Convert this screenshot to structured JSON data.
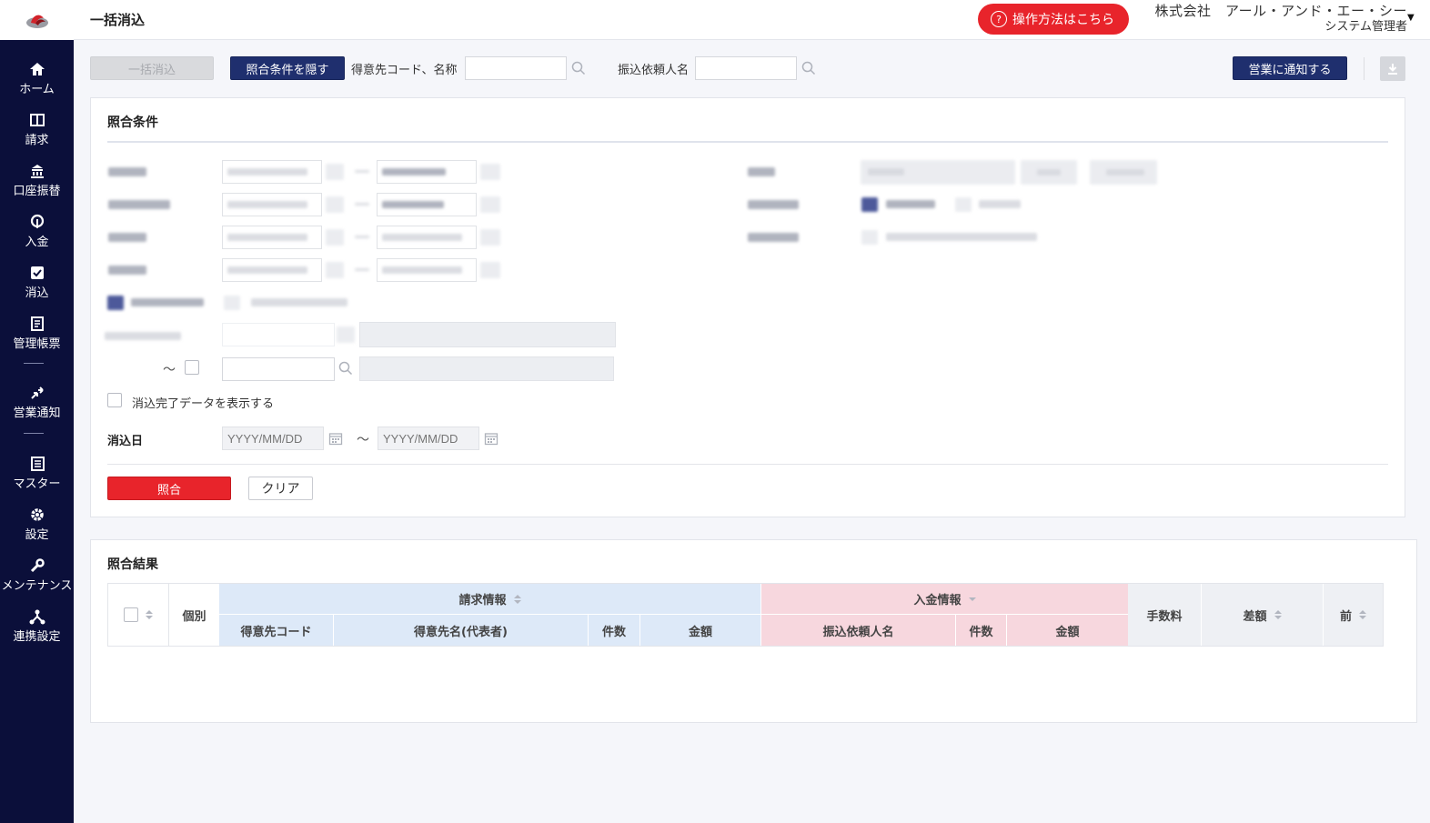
{
  "header": {
    "title": "一括消込",
    "help_button": "操作方法はこちら",
    "company": "株式会社　アール・アンド・エー・シー",
    "role": "システム管理者"
  },
  "sidebar": {
    "items": [
      {
        "label": "ホーム",
        "icon": "home-icon"
      },
      {
        "label": "請求",
        "icon": "book-icon"
      },
      {
        "label": "口座振替",
        "icon": "bank-icon"
      },
      {
        "label": "入金",
        "icon": "deposit-icon"
      },
      {
        "label": "消込",
        "icon": "check-icon"
      },
      {
        "label": "管理帳票",
        "icon": "report-icon"
      },
      {
        "label": "営業通知",
        "icon": "notify-icon"
      },
      {
        "label": "マスター",
        "icon": "master-icon"
      },
      {
        "label": "設定",
        "icon": "gear-icon"
      },
      {
        "label": "メンテナンス",
        "icon": "wrench-icon"
      },
      {
        "label": "連携設定",
        "icon": "link-icon"
      }
    ]
  },
  "toolbar": {
    "bulk_button": "一括消込",
    "hide_conditions_button": "照合条件を隠す",
    "customer_label": "得意先コード、名称",
    "customer_value": "",
    "payer_label": "振込依頼人名",
    "payer_value": "",
    "notify_button": "営業に通知する"
  },
  "conditions": {
    "title": "照合条件",
    "show_completed_label": "消込完了データを表示する",
    "date_label": "消込日",
    "date_from_placeholder": "YYYY/MM/DD",
    "date_to_placeholder": "YYYY/MM/DD",
    "tilde": "～",
    "match_button": "照合",
    "clear_button": "クリア"
  },
  "results": {
    "title": "照合結果",
    "columns": {
      "individual": "個別",
      "billing_info": "請求情報",
      "deposit_info": "入金情報",
      "fee": "手数料",
      "difference": "差額",
      "prev": "前",
      "customer_code": "得意先コード",
      "customer_name": "得意先名(代表者)",
      "bill_count": "件数",
      "bill_amount": "金額",
      "payer_name": "振込依頼人名",
      "dep_count": "件数",
      "dep_amount": "金額"
    }
  },
  "colors": {
    "sidebar": "#0b0f3a",
    "accent_red": "#e8242b",
    "navy_button": "#1f2f6e",
    "billing_header": "#dde9f8",
    "deposit_header": "#f7d7de"
  }
}
